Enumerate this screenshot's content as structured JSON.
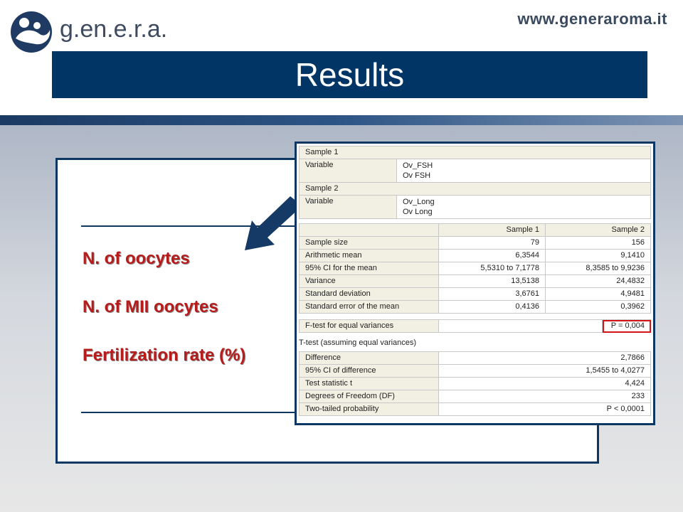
{
  "header": {
    "brand": "g.en.e.r.a.",
    "url": "www.generaroma.it",
    "title": "Results"
  },
  "outcomes": [
    "N. of oocytes",
    "N. of MII oocytes",
    "Fertilization rate (%)"
  ],
  "stats": {
    "sample1_label": "Sample 1",
    "sample1_variable_label": "Variable",
    "sample1_variable_value1": "Ov_FSH",
    "sample1_variable_value2": "Ov FSH",
    "sample2_label": "Sample 2",
    "sample2_variable_label": "Variable",
    "sample2_variable_value1": "Ov_Long",
    "sample2_variable_value2": "Ov Long",
    "col_sample1": "Sample 1",
    "col_sample2": "Sample 2",
    "rows": [
      {
        "label": "Sample size",
        "s1": "79",
        "s2": "156"
      },
      {
        "label": "Arithmetic mean",
        "s1": "6,3544",
        "s2": "9,1410"
      },
      {
        "label": "95% CI for the mean",
        "s1": "5,5310 to 7,1778",
        "s2": "8,3585 to 9,9236"
      },
      {
        "label": "Variance",
        "s1": "13,5138",
        "s2": "24,4832"
      },
      {
        "label": "Standard deviation",
        "s1": "3,6761",
        "s2": "4,9481"
      },
      {
        "label": "Standard error of the mean",
        "s1": "0,4136",
        "s2": "0,3962"
      }
    ],
    "ftest_label": "F-test for equal variances",
    "ftest_value": "P = 0,004",
    "ttest_title": "T-test (assuming equal variances)",
    "trows": [
      {
        "label": "Difference",
        "value": "2,7866"
      },
      {
        "label": "95% CI of difference",
        "value": "1,5455 to 4,0277"
      },
      {
        "label": "Test statistic t",
        "value": "4,424"
      },
      {
        "label": "Degrees of Freedom (DF)",
        "value": "233"
      },
      {
        "label": "Two-tailed probability",
        "value": "P < 0,0001"
      }
    ]
  },
  "colors": {
    "navy": "#003566",
    "accent_red": "#b71c1c",
    "highlight_red": "#d41515"
  }
}
